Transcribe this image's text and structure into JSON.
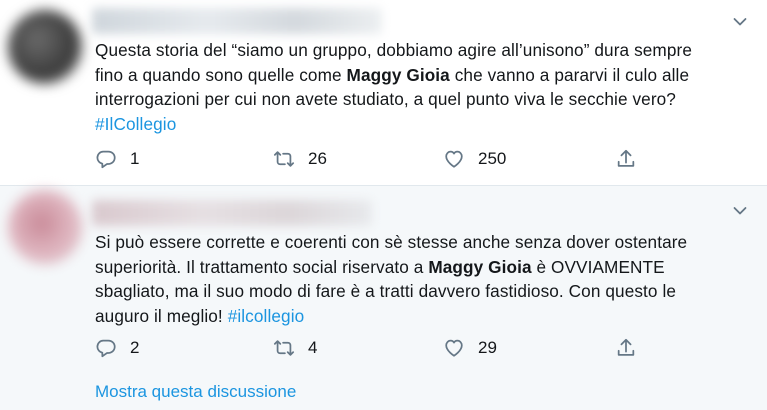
{
  "tweets": [
    {
      "text_parts": [
        "Questa storia del “siamo un gruppo, dobbiamo agire all’unisono” dura sempre fino a quando sono quelle come ",
        "Maggy Gioia",
        " che vanno a pararvi il culo alle interrogazioni per cui non avete studiato, a quel punto viva le secchie vero? ",
        "#IlCollegio"
      ],
      "replies": "1",
      "retweets": "26",
      "likes": "250"
    },
    {
      "text_parts": [
        "Si può essere corrette e coerenti con sè stesse anche senza dover ostentare superiorità. Il trattamento social riservato a ",
        "Maggy Gioia",
        " è OVVIAMENTE sbagliato, ma il suo modo di fare è a tratti davvero fastidioso. Con questo le auguro il meglio! ",
        "#ilcollegio"
      ],
      "replies": "2",
      "retweets": "4",
      "likes": "29"
    }
  ],
  "thread_link": "Mostra questa discussione",
  "colors": {
    "accent": "#1b95e0",
    "icon": "#657786",
    "second_background": "#f5f8fa"
  },
  "icons": [
    "chevron-down-icon",
    "reply-icon",
    "retweet-icon",
    "like-icon",
    "share-icon"
  ]
}
